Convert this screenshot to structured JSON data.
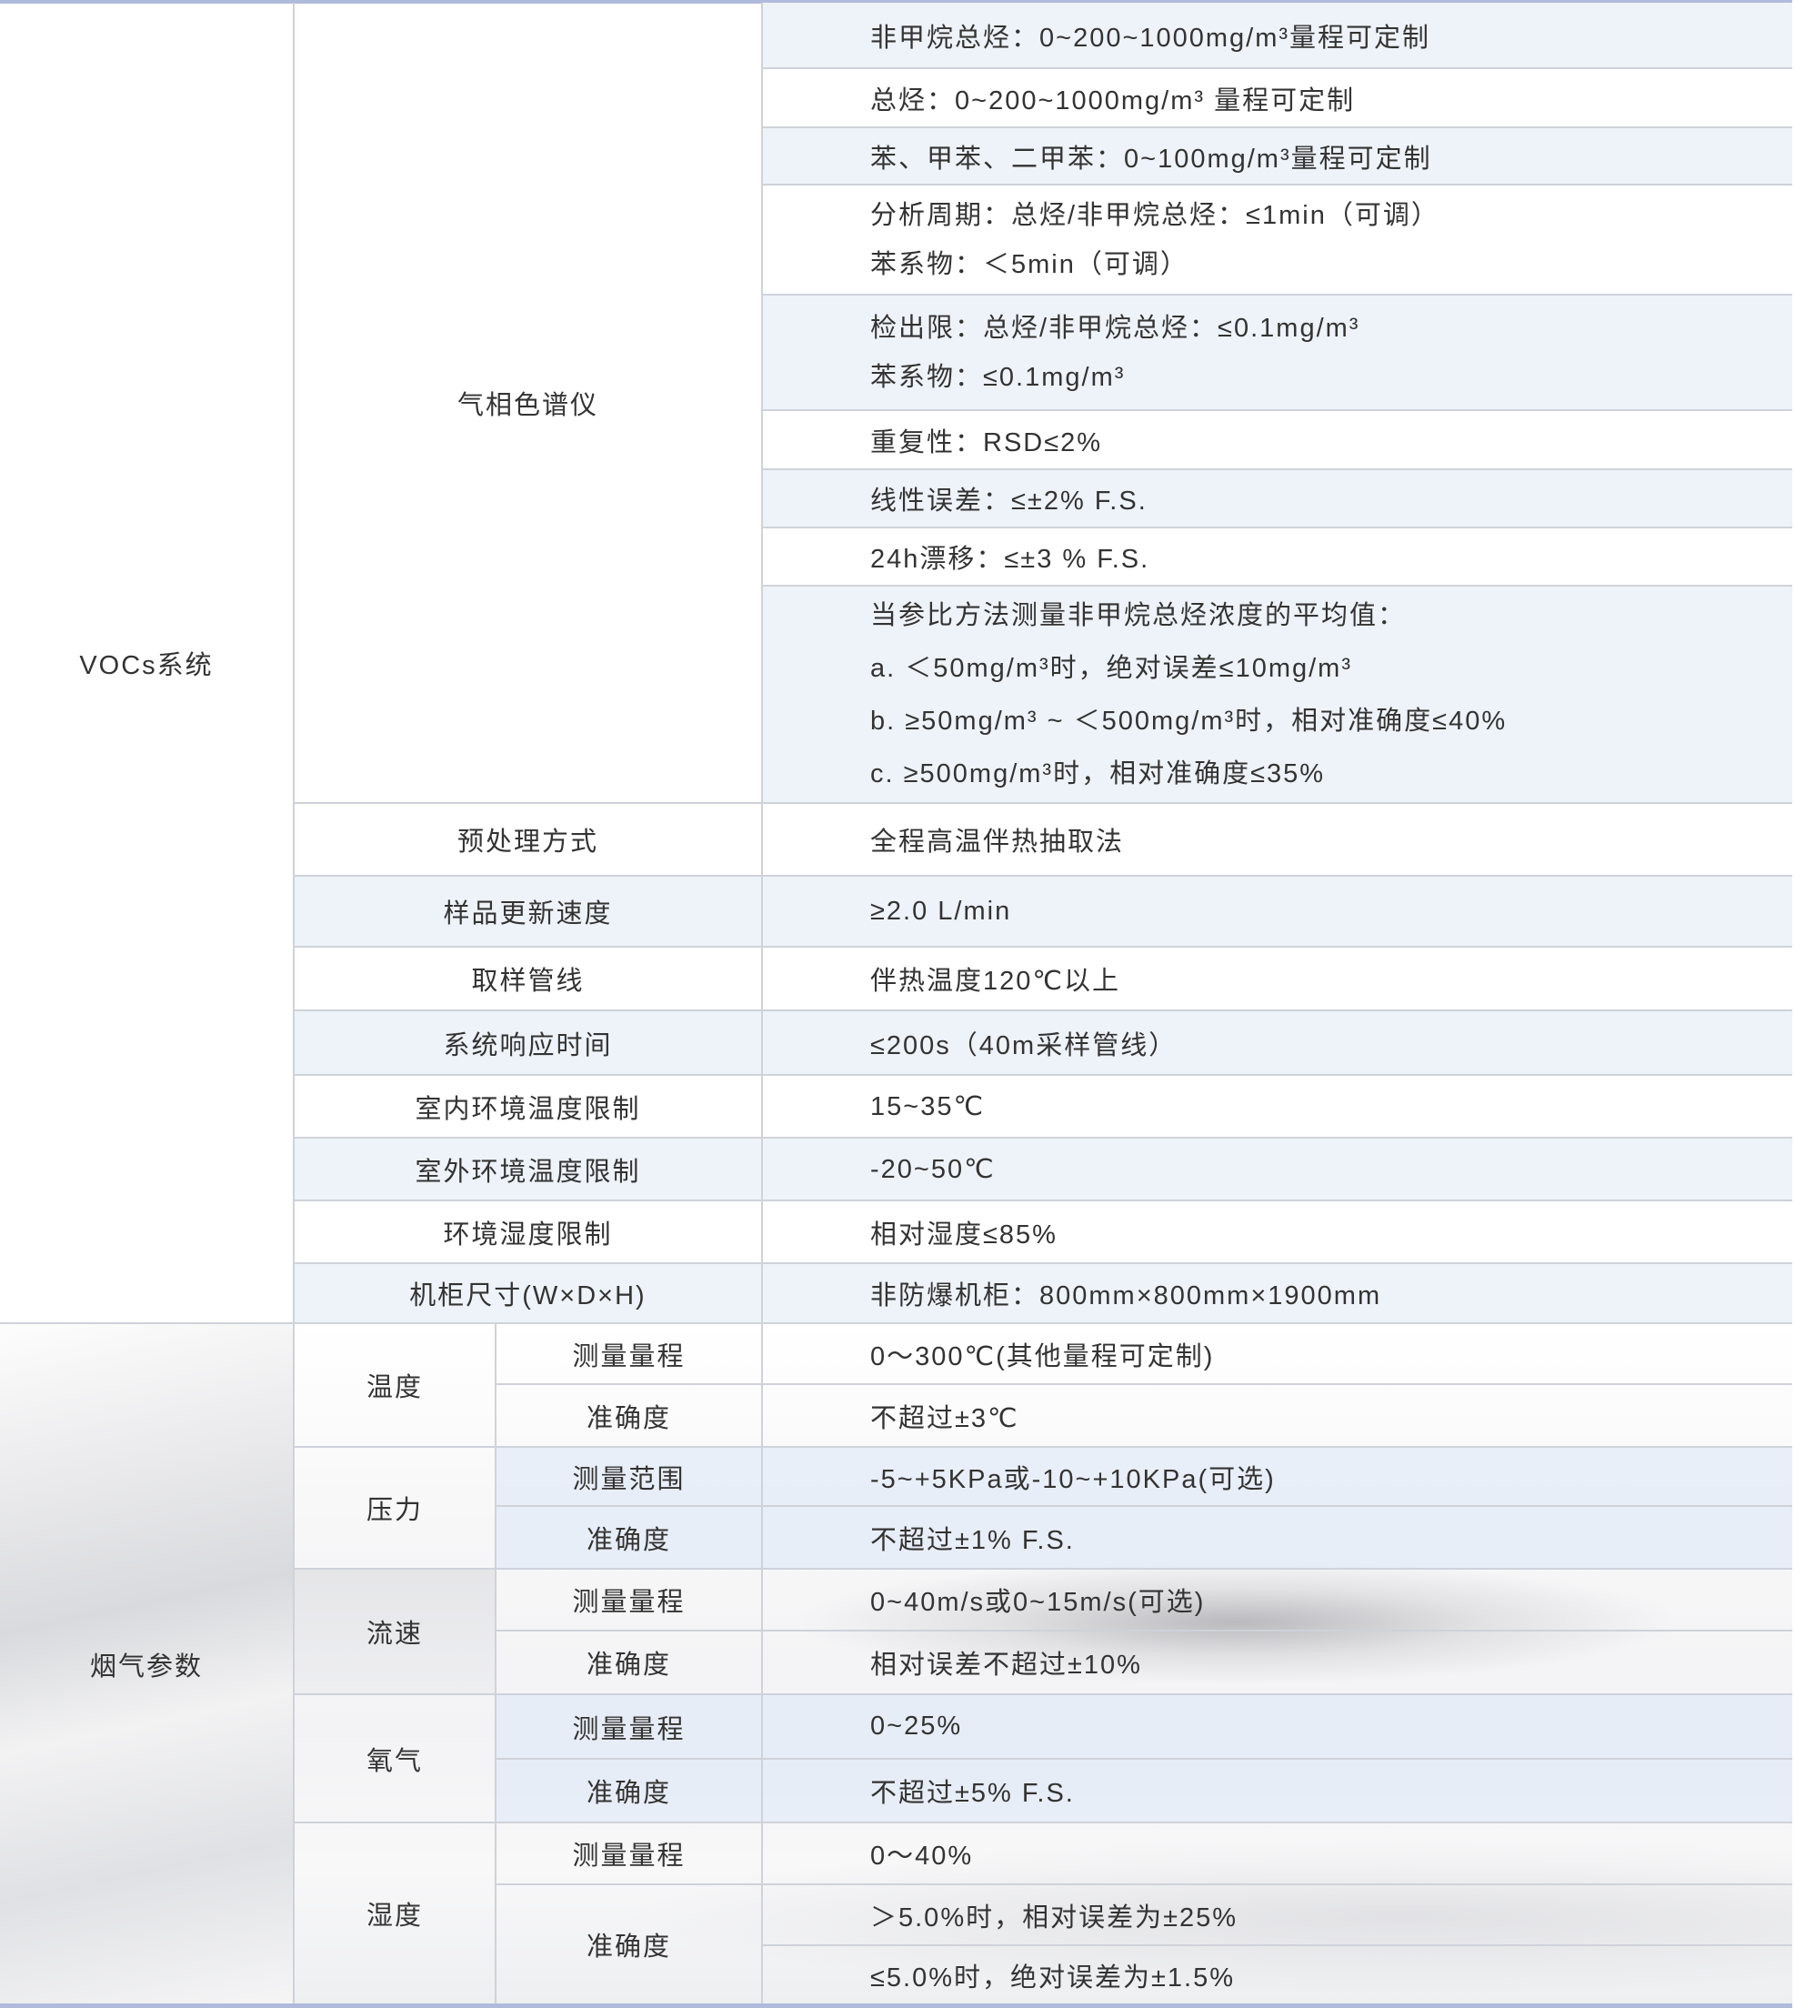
{
  "colors": {
    "row_tint": "#eef3fa",
    "border": "#cfd2d9",
    "text": "#333333",
    "accent_line": "#b0badb"
  },
  "vocs": {
    "label": "VOCs系统",
    "gc": {
      "label": "气相色谱仪",
      "specs": [
        [
          "非甲烷总烃：0~200~1000mg/m³量程可定制"
        ],
        [
          "总烃：0~200~1000mg/m³ 量程可定制"
        ],
        [
          "苯、甲苯、二甲苯：0~100mg/m³量程可定制"
        ],
        [
          "分析周期：总烃/非甲烷总烃：≤1min（可调）",
          "苯系物：＜5min（可调）"
        ],
        [
          "检出限：总烃/非甲烷总烃：≤0.1mg/m³",
          "苯系物：≤0.1mg/m³"
        ],
        [
          "重复性：RSD≤2%"
        ],
        [
          "线性误差：≤±2% F.S."
        ],
        [
          "24h漂移：≤±3 % F.S."
        ],
        [
          "当参比方法测量非甲烷总烃浓度的平均值：",
          "a. ＜50mg/m³时，绝对误差≤10mg/m³",
          "b. ≥50mg/m³ ~ ＜500mg/m³时，相对准确度≤40%",
          "c. ≥500mg/m³时，相对准确度≤35%"
        ]
      ]
    },
    "rows": [
      {
        "label": "预处理方式",
        "value": "全程高温伴热抽取法"
      },
      {
        "label": "样品更新速度",
        "value": "≥2.0 L/min"
      },
      {
        "label": "取样管线",
        "value": "伴热温度120℃以上"
      },
      {
        "label": "系统响应时间",
        "value": "≤200s（40m采样管线）"
      },
      {
        "label": "室内环境温度限制",
        "value": "15~35℃"
      },
      {
        "label": "室外环境温度限制",
        "value": "-20~50℃"
      },
      {
        "label": "环境湿度限制",
        "value": "相对湿度≤85%"
      },
      {
        "label": "机柜尺寸(W×D×H)",
        "value": "非防爆机柜：800mm×800mm×1900mm"
      }
    ]
  },
  "flue_gas": {
    "label": "烟气参数",
    "params": [
      {
        "name": "温度",
        "items": [
          {
            "label": "测量量程",
            "values": [
              "0～300℃(其他量程可定制)"
            ]
          },
          {
            "label": "准确度",
            "values": [
              "不超过±3℃"
            ]
          }
        ]
      },
      {
        "name": "压力",
        "items": [
          {
            "label": "测量范围",
            "values": [
              "-5~+5KPa或-10~+10KPa(可选)"
            ]
          },
          {
            "label": "准确度",
            "values": [
              "不超过±1% F.S."
            ]
          }
        ]
      },
      {
        "name": "流速",
        "items": [
          {
            "label": "测量量程",
            "values": [
              "0~40m/s或0~15m/s(可选)"
            ]
          },
          {
            "label": "准确度",
            "values": [
              "相对误差不超过±10%"
            ]
          }
        ]
      },
      {
        "name": "氧气",
        "items": [
          {
            "label": "测量量程",
            "values": [
              "0~25%"
            ]
          },
          {
            "label": "准确度",
            "values": [
              "不超过±5% F.S."
            ]
          }
        ]
      },
      {
        "name": "湿度",
        "items": [
          {
            "label": "测量量程",
            "values": [
              "0～40%"
            ]
          },
          {
            "label": "准确度",
            "values": [
              "＞5.0%时，相对误差为±25%",
              "≤5.0%时，绝对误差为±1.5%"
            ]
          }
        ]
      }
    ]
  }
}
